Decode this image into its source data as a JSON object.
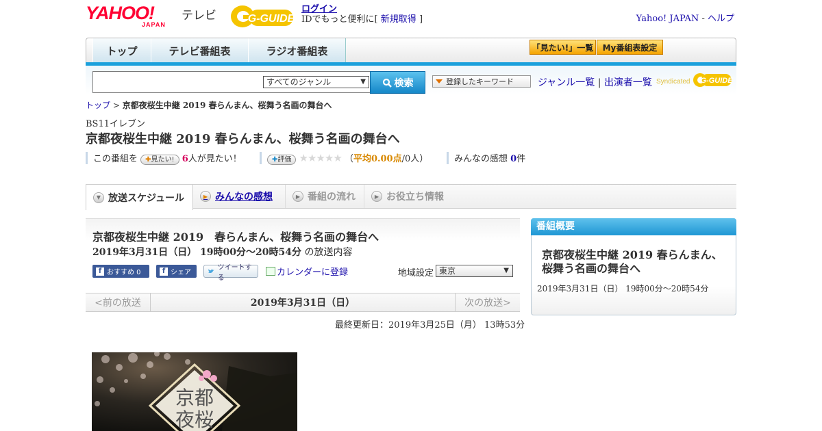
{
  "header": {
    "logo_main": "YAHOO!",
    "logo_sub": "JAPAN",
    "logo_service": "テレビ",
    "gguide_logo": "G-GUIDE",
    "login_label": "ログイン",
    "id_text_prefix": "IDでもっと便利に[",
    "register_label": "新規取得",
    "id_text_suffix": "]",
    "yahoo_japan_link": "Yahoo! JAPAN",
    "link_sep": "-",
    "help_link": "ヘルプ"
  },
  "nav": {
    "tabs": [
      {
        "label": "トップ"
      },
      {
        "label": "テレビ番組表"
      },
      {
        "label": "ラジオ番組表"
      }
    ],
    "mitai_list_label": "「見たい!」一覧",
    "my_schedule_label": "My番組表設定"
  },
  "search": {
    "input_value": "",
    "genre_selected": "すべてのジャンル",
    "search_button_label": "検索",
    "keyword_button_label": "登録したキーワード",
    "genre_list_link": "ジャンル一覧",
    "links_sep": "|",
    "performer_list_link": "出演者一覧",
    "syndicated_label": "Syndicated"
  },
  "breadcrumb": {
    "home": "トップ",
    "sep": ">",
    "current": "京都夜桜生中継 2019 春らんまん、桜舞う名画の舞台へ"
  },
  "program": {
    "channel": "BS11イレブン",
    "title": "京都夜桜生中継 2019 春らんまん、桜舞う名画の舞台へ"
  },
  "rating_row": {
    "this_program": "この番組を",
    "mitai_pill": "見たい!",
    "mitai_count": "6",
    "mitai_suffix": "人が見たい！",
    "review_pill": "評価",
    "stars": "★★★★★",
    "avg_open": "（",
    "avg_label": "平均0.00点",
    "avg_people": "/0人）",
    "impressions_label": "みんなの感想",
    "impressions_count": "0",
    "impressions_suffix": "件"
  },
  "tabs": [
    {
      "label": "放送スケジュール"
    },
    {
      "label": "みんなの感想"
    },
    {
      "label": "番組の流れ"
    },
    {
      "label": "お役立ち情報"
    }
  ],
  "schedule": {
    "title": "京都夜桜生中継 2019　春らんまん、桜舞う名画の舞台へ",
    "datetime": "2019年3月31日（日）  19時00分～20時54分",
    "datetime_suffix": "の放送内容",
    "recommend_label": "おすすめ 0",
    "share_label": "シェア",
    "tweet_label": "ツイートする",
    "calendar_label": "カレンダーに登録",
    "region_label": "地域設定",
    "region_selected": "東京",
    "prev_label": "<前の放送",
    "current_date": "2019年3月31日（日）",
    "next_label": "次の放送>",
    "updated": "最終更新日：2019年3月25日（月）  13時53分"
  },
  "image": {
    "text_line1": "京都",
    "text_line2": "夜桜"
  },
  "overview": {
    "heading": "番組概要",
    "title": "京都夜桜生中継 2019 春らんまん、桜舞う名画の舞台へ",
    "time": "2019年3月31日（日）  19時00分～20時54分"
  },
  "colors": {
    "accent_blue": "#1aa0dc",
    "link": "#1a0dab",
    "yahoo_red": "#ff0033",
    "pink": "#d6005c",
    "orange": "#d88800"
  }
}
